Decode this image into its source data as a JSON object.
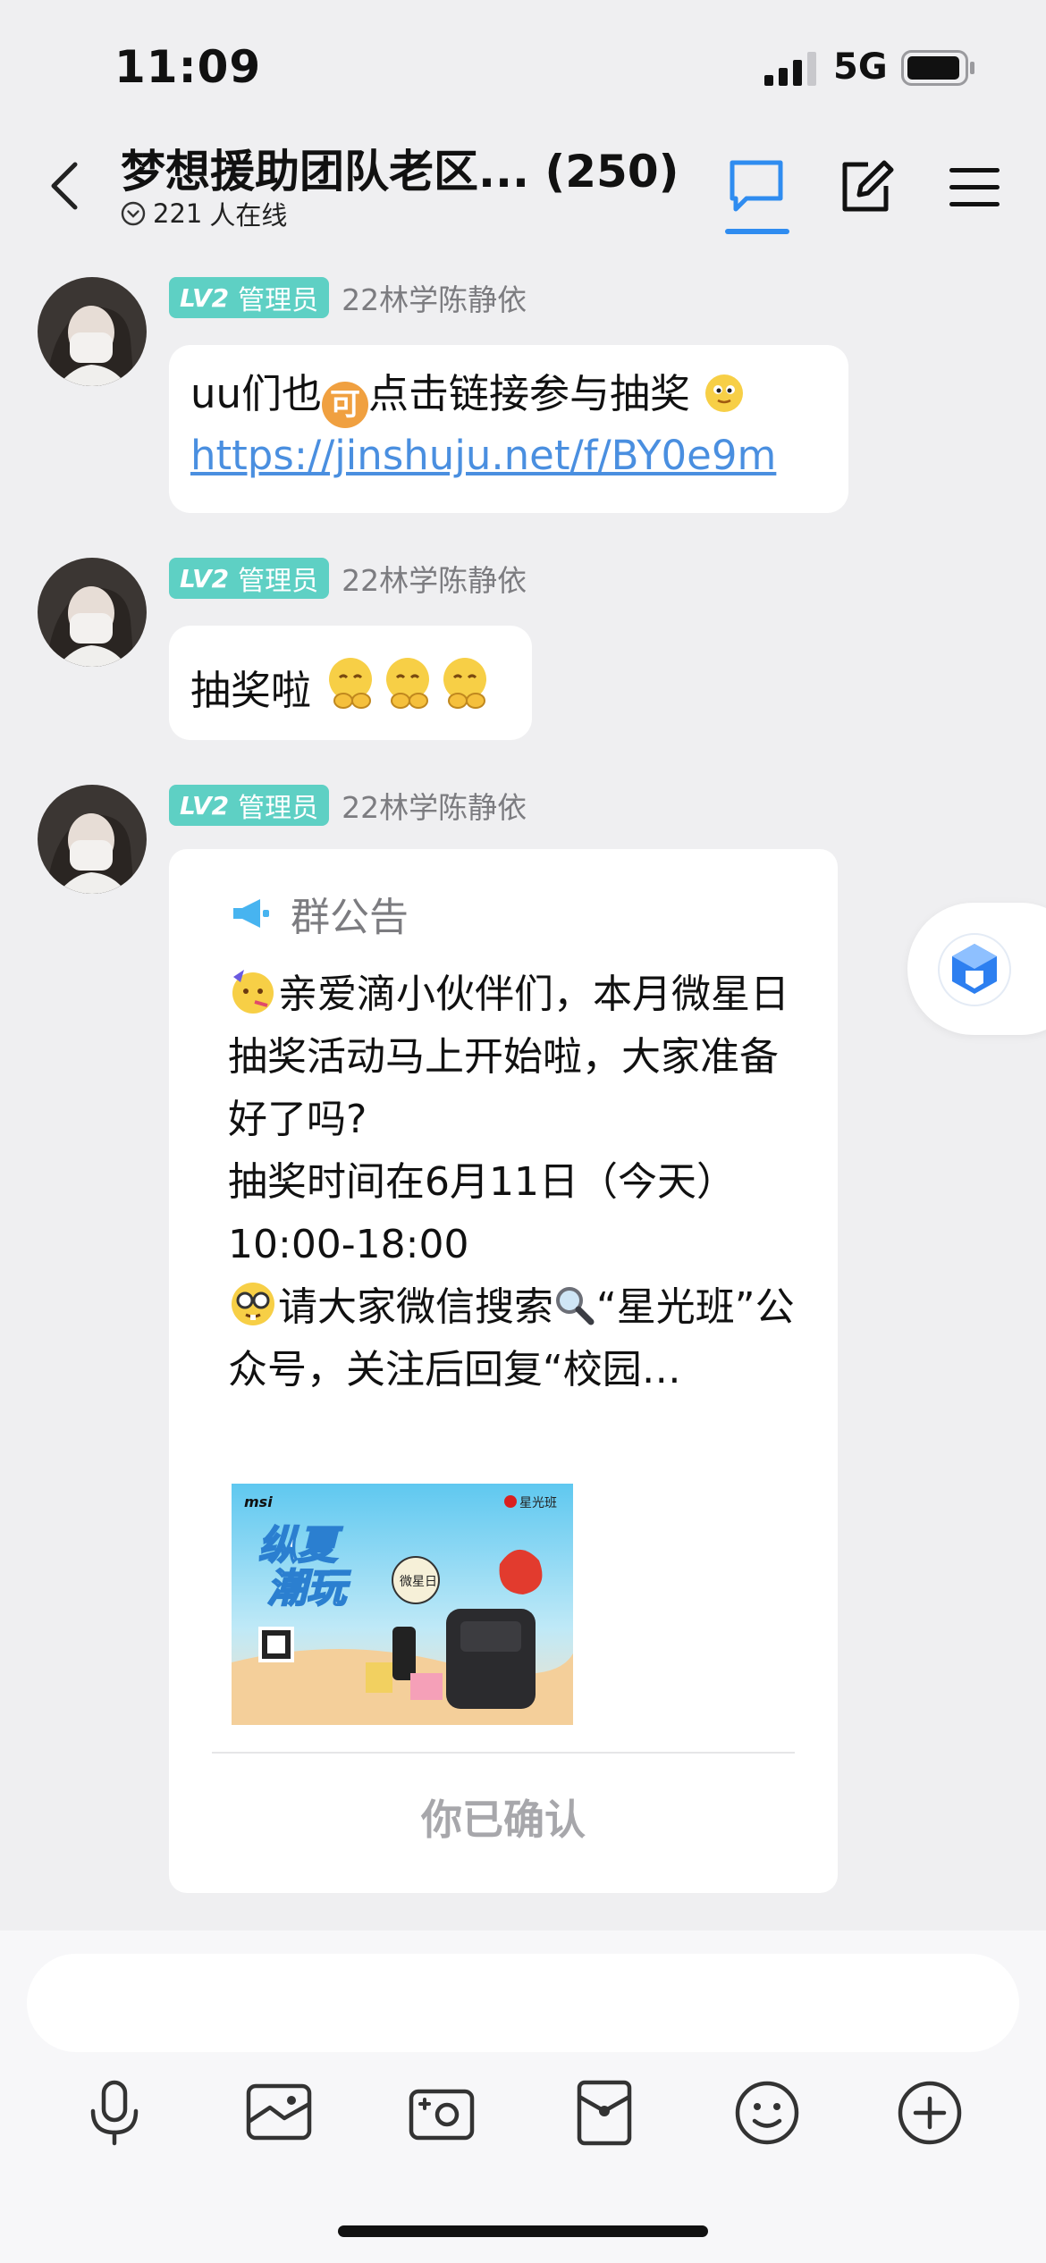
{
  "status": {
    "time": "11:09",
    "network": "5G"
  },
  "header": {
    "title": "梦想援助团队老区... (250)",
    "online_count": "221",
    "online_label": "人在线"
  },
  "messages": [
    {
      "badge_level": "LV2",
      "badge_role": "管理员",
      "sender": "22林学陈静依",
      "text_before": "uu们也",
      "inline_badge": "可",
      "text_after": "点击链接参与抽奖",
      "link": "https://jinshuju.net/f/BY0e9m"
    },
    {
      "badge_level": "LV2",
      "badge_role": "管理员",
      "sender": "22林学陈静依",
      "text": "抽奖啦"
    },
    {
      "badge_level": "LV2",
      "badge_role": "管理员",
      "sender": "22林学陈静依",
      "notice": {
        "label": "群公告",
        "line1": "亲爱滴小伙伴们，本月微星日抽奖活动马上开始啦，大家准备好了吗?",
        "line2": "抽奖时间在6月11日（今天）10:00-18:00",
        "line3_a": "请大家微信搜索",
        "line3_b": "“星光班”公众号，关注后回复“校园…",
        "poster": {
          "brand": "msi",
          "partner": "星光班",
          "headline_1": "纵夏",
          "headline_2": "潮玩",
          "stamp": "微星日"
        },
        "confirm_label": "你已确认"
      }
    }
  ],
  "input": {
    "placeholder": "",
    "value": ""
  },
  "icons": {
    "toolbar": [
      "microphone-icon",
      "image-icon",
      "camera-icon",
      "red-packet-icon",
      "emoji-icon",
      "plus-icon"
    ]
  },
  "colors": {
    "accent": "#2f8cf0",
    "badge": "#5ed0c4",
    "link": "#4a8fe0",
    "background": "#efeff1"
  }
}
